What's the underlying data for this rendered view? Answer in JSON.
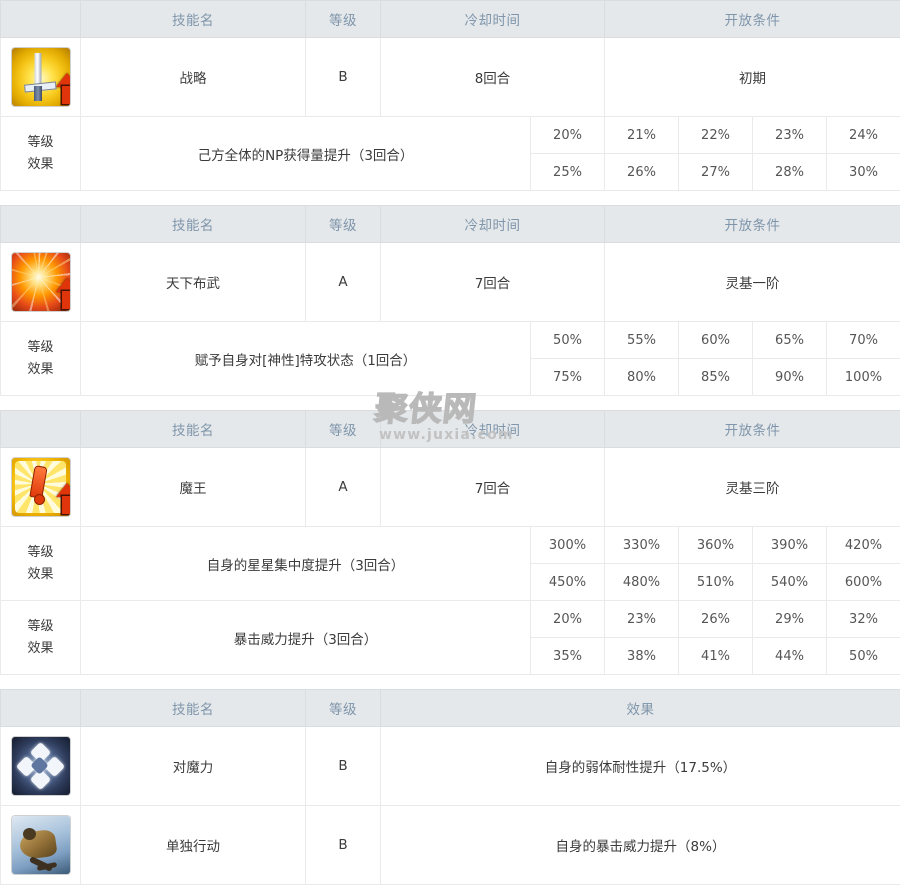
{
  "headers": {
    "skill_name": "技能名",
    "rank": "等级",
    "cooldown": "冷却时间",
    "unlock": "开放条件",
    "effect": "效果",
    "level_effect_line1": "等级",
    "level_effect_line2": "效果"
  },
  "watermark": {
    "text": "聚侠网",
    "url": "www.juxia.com"
  },
  "active_skills": [
    {
      "icon": "sword-buff-icon",
      "name": "战略",
      "rank": "B",
      "cooldown": "8回合",
      "unlock": "初期",
      "effects": [
        {
          "desc": "己方全体的NP获得量提升（3回合）",
          "row1": [
            "20%",
            "21%",
            "22%",
            "23%",
            "24%"
          ],
          "row2": [
            "25%",
            "26%",
            "27%",
            "28%",
            "30%"
          ]
        }
      ]
    },
    {
      "icon": "explosion-buff-icon",
      "name": "天下布武",
      "rank": "A",
      "cooldown": "7回合",
      "unlock": "灵基一阶",
      "effects": [
        {
          "desc": "赋予自身对[神性]特攻状态（1回合）",
          "row1": [
            "50%",
            "55%",
            "60%",
            "65%",
            "70%"
          ],
          "row2": [
            "75%",
            "80%",
            "85%",
            "90%",
            "100%"
          ]
        }
      ]
    },
    {
      "icon": "exclamation-buff-icon",
      "name": "魔王",
      "rank": "A",
      "cooldown": "7回合",
      "unlock": "灵基三阶",
      "effects": [
        {
          "desc": "自身的星星集中度提升（3回合）",
          "row1": [
            "300%",
            "330%",
            "360%",
            "390%",
            "420%"
          ],
          "row2": [
            "450%",
            "480%",
            "510%",
            "540%",
            "600%"
          ]
        },
        {
          "desc": "暴击威力提升（3回合）",
          "row1": [
            "20%",
            "23%",
            "26%",
            "29%",
            "32%"
          ],
          "row2": [
            "35%",
            "38%",
            "41%",
            "44%",
            "50%"
          ]
        }
      ]
    }
  ],
  "passive_skills": [
    {
      "icon": "magic-resistance-icon",
      "name": "对魔力",
      "rank": "B",
      "effect": "自身的弱体耐性提升（17.5%）"
    },
    {
      "icon": "independent-action-icon",
      "name": "单独行动",
      "rank": "B",
      "effect": "自身的暴击威力提升（8%）"
    }
  ]
}
